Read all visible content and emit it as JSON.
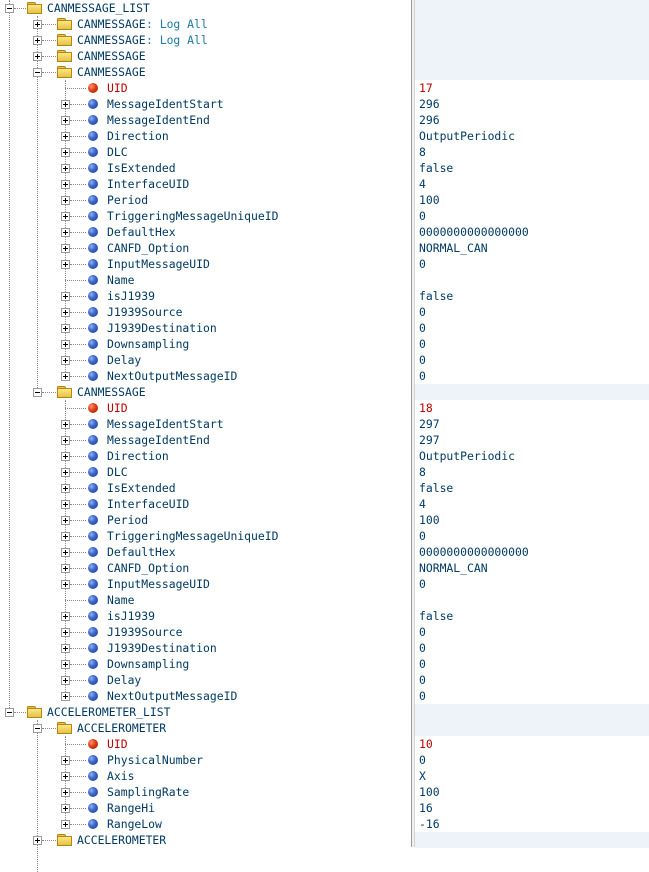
{
  "tree": {
    "root": {
      "label": "CANMESSAGE_LIST"
    },
    "collapsed_messages": [
      {
        "label": "CANMESSAGE",
        "suffix": " : Log All"
      },
      {
        "label": "CANMESSAGE",
        "suffix": " : Log All"
      },
      {
        "label": "CANMESSAGE",
        "suffix": ""
      }
    ],
    "messages": [
      {
        "label": "CANMESSAGE",
        "fields": [
          {
            "name": "UID",
            "value": "17"
          },
          {
            "name": "MessageIdentStart",
            "value": "296"
          },
          {
            "name": "MessageIdentEnd",
            "value": "296"
          },
          {
            "name": "Direction",
            "value": "OutputPeriodic"
          },
          {
            "name": "DLC",
            "value": "8"
          },
          {
            "name": "IsExtended",
            "value": "false"
          },
          {
            "name": "InterfaceUID",
            "value": "4"
          },
          {
            "name": "Period",
            "value": "100"
          },
          {
            "name": "TriggeringMessageUniqueID",
            "value": "0"
          },
          {
            "name": "DefaultHex",
            "value": "0000000000000000"
          },
          {
            "name": "CANFD_Option",
            "value": "NORMAL_CAN"
          },
          {
            "name": "InputMessageUID",
            "value": "0"
          },
          {
            "name": "Name",
            "value": ""
          },
          {
            "name": "isJ1939",
            "value": "false"
          },
          {
            "name": "J1939Source",
            "value": "0"
          },
          {
            "name": "J1939Destination",
            "value": "0"
          },
          {
            "name": "Downsampling",
            "value": "0"
          },
          {
            "name": "Delay",
            "value": "0"
          },
          {
            "name": "NextOutputMessageID",
            "value": "0"
          }
        ]
      },
      {
        "label": "CANMESSAGE",
        "fields": [
          {
            "name": "UID",
            "value": "18"
          },
          {
            "name": "MessageIdentStart",
            "value": "297"
          },
          {
            "name": "MessageIdentEnd",
            "value": "297"
          },
          {
            "name": "Direction",
            "value": "OutputPeriodic"
          },
          {
            "name": "DLC",
            "value": "8"
          },
          {
            "name": "IsExtended",
            "value": "false"
          },
          {
            "name": "InterfaceUID",
            "value": "4"
          },
          {
            "name": "Period",
            "value": "100"
          },
          {
            "name": "TriggeringMessageUniqueID",
            "value": "0"
          },
          {
            "name": "DefaultHex",
            "value": "0000000000000000"
          },
          {
            "name": "CANFD_Option",
            "value": "NORMAL_CAN"
          },
          {
            "name": "InputMessageUID",
            "value": "0"
          },
          {
            "name": "Name",
            "value": ""
          },
          {
            "name": "isJ1939",
            "value": "false"
          },
          {
            "name": "J1939Source",
            "value": "0"
          },
          {
            "name": "J1939Destination",
            "value": "0"
          },
          {
            "name": "Downsampling",
            "value": "0"
          },
          {
            "name": "Delay",
            "value": "0"
          },
          {
            "name": "NextOutputMessageID",
            "value": "0"
          }
        ]
      }
    ],
    "accel_root": {
      "label": "ACCELEROMETER_LIST"
    },
    "accelerometers": [
      {
        "label": "ACCELEROMETER",
        "fields": [
          {
            "name": "UID",
            "value": "10"
          },
          {
            "name": "PhysicalNumber",
            "value": "0"
          },
          {
            "name": "Axis",
            "value": "X"
          },
          {
            "name": "SamplingRate",
            "value": "100"
          },
          {
            "name": "RangeHi",
            "value": "16"
          },
          {
            "name": "RangeLow",
            "value": "-16"
          }
        ]
      }
    ],
    "last_accelerometer": {
      "label": "ACCELEROMETER"
    }
  },
  "colors": {
    "label": "#003a63",
    "uid": "#c00000",
    "shade": "#eef3fa"
  }
}
